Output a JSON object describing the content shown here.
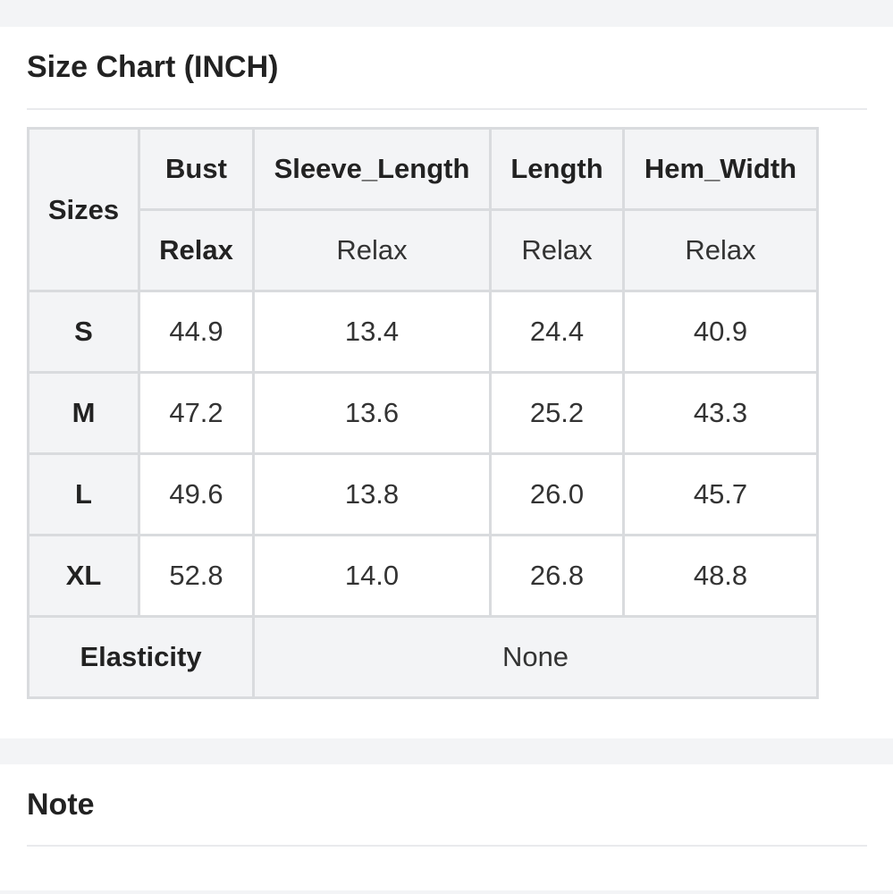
{
  "size_chart": {
    "title": "Size Chart (INCH)",
    "row_header_label": "Sizes",
    "columns": [
      "Bust",
      "Sleeve_Length",
      "Length",
      "Hem_Width"
    ],
    "fit_row": [
      "Relax",
      "Relax",
      "Relax",
      "Relax"
    ],
    "rows": [
      {
        "size": "S",
        "values": [
          "44.9",
          "13.4",
          "24.4",
          "40.9"
        ]
      },
      {
        "size": "M",
        "values": [
          "47.2",
          "13.6",
          "25.2",
          "43.3"
        ]
      },
      {
        "size": "L",
        "values": [
          "49.6",
          "13.8",
          "26.0",
          "45.7"
        ]
      },
      {
        "size": "XL",
        "values": [
          "52.8",
          "14.0",
          "26.8",
          "48.8"
        ]
      }
    ],
    "elasticity_label": "Elasticity",
    "elasticity_value": "None"
  },
  "note": {
    "title": "Note"
  }
}
